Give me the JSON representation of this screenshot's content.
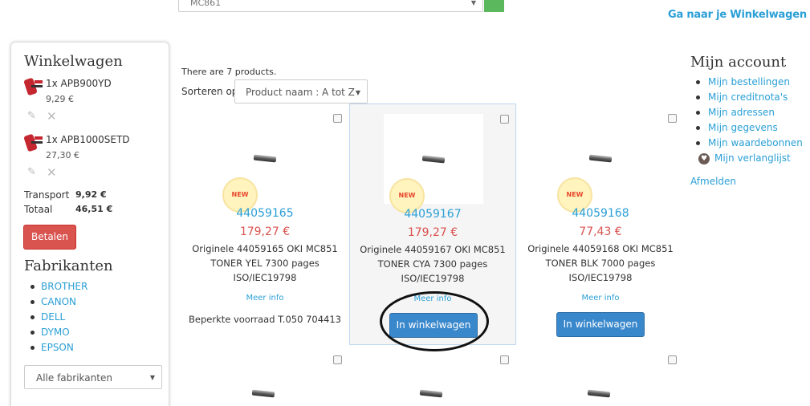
{
  "header": {
    "search_value": "MC861",
    "cart_link": "Ga naar je Winkelwagen"
  },
  "sidebar": {
    "cart_title": "Winkelwagen",
    "cart_items": [
      {
        "qty_ref": "1x APB900YD",
        "price": "9,29 €"
      },
      {
        "qty_ref": "1x APB1000SETD",
        "price": "27,30 €"
      }
    ],
    "shipping_label": "Transport",
    "shipping_value": "9,92 €",
    "total_label": "Totaal",
    "total_value": "46,51 €",
    "checkout_label": "Betalen",
    "brands_title": "Fabrikanten",
    "brands": [
      "BROTHER",
      "CANON",
      "DELL",
      "DYMO",
      "EPSON"
    ],
    "brand_select": "Alle fabrikanten"
  },
  "listing": {
    "count_text": "There are 7 products.",
    "sort_label": "Sorteren op",
    "sort_value": "Product naam : A tot Z"
  },
  "products": [
    {
      "badge": "NEW",
      "ref": "44059165",
      "price": "179,27 €",
      "desc_lines": [
        "Originele 44059165 OKI MC851",
        "TONER YEL 7300 pages",
        "ISO/IEC19798"
      ],
      "more": "Meer info",
      "stock": "Beperkte voorraad T.050 704413"
    },
    {
      "badge": "NEW",
      "ref": "44059167",
      "price": "179,27 €",
      "desc_lines": [
        "Originele 44059167 OKI MC851",
        "TONER CYA 7300 pages",
        "ISO/IEC19798"
      ],
      "more": "Meer info",
      "button": "In winkelwagen"
    },
    {
      "badge": "NEW",
      "ref": "44059168",
      "price": "77,43 €",
      "desc_lines": [
        "Originele 44059168 OKI MC851",
        "TONER BLK 7000 pages",
        "ISO/IEC19798"
      ],
      "more": "Meer info",
      "button": "In winkelwagen"
    }
  ],
  "account": {
    "title": "Mijn account",
    "links": [
      "Mijn bestellingen",
      "Mijn creditnota's",
      "Mijn adressen",
      "Mijn gegevens",
      "Mijn waardebonnen",
      "Mijn verlanglijst"
    ],
    "logout": "Afmelden"
  }
}
